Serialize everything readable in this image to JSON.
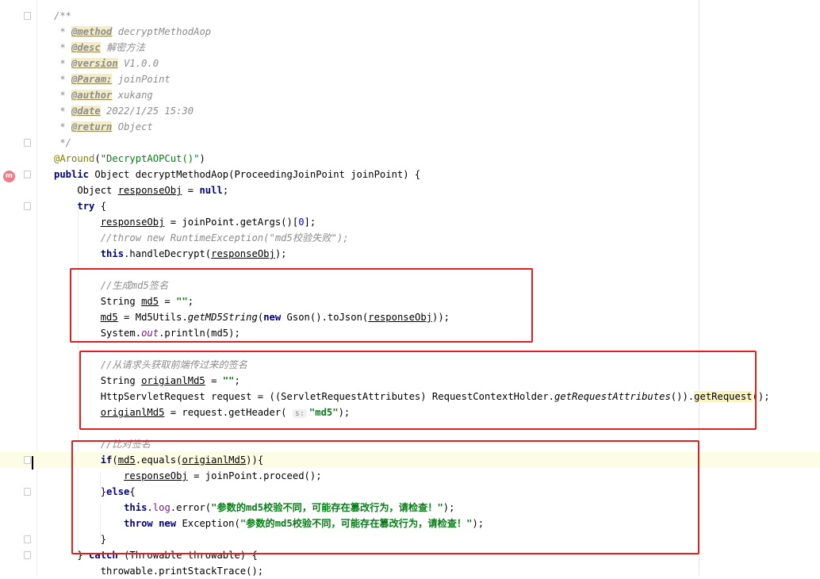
{
  "editor": {
    "accent_color": "#e02020",
    "gutter_icon": "override-method-icon",
    "gutter_icon_text": "m",
    "inlay_hint": "s:",
    "lines": [
      {
        "segments": [
          {
            "t": "/**",
            "c": "cm"
          }
        ]
      },
      {
        "segments": [
          {
            "t": " * ",
            "c": "cm"
          },
          {
            "t": "@method",
            "c": "tag"
          },
          {
            "t": " decryptMethodAop",
            "c": "cm"
          }
        ]
      },
      {
        "segments": [
          {
            "t": " * ",
            "c": "cm"
          },
          {
            "t": "@desc",
            "c": "tag"
          },
          {
            "t": " 解密方法",
            "c": "cm"
          }
        ]
      },
      {
        "segments": [
          {
            "t": " * ",
            "c": "cm"
          },
          {
            "t": "@version",
            "c": "tag"
          },
          {
            "t": " V1.0.0",
            "c": "cm"
          }
        ]
      },
      {
        "segments": [
          {
            "t": " * ",
            "c": "cm"
          },
          {
            "t": "@Param:",
            "c": "tag"
          },
          {
            "t": " joinPoint",
            "c": "cm"
          }
        ]
      },
      {
        "segments": [
          {
            "t": " * ",
            "c": "cm"
          },
          {
            "t": "@author",
            "c": "tag"
          },
          {
            "t": " xukang",
            "c": "cm"
          }
        ]
      },
      {
        "segments": [
          {
            "t": " * ",
            "c": "cm"
          },
          {
            "t": "@date",
            "c": "tag"
          },
          {
            "t": " 2022/1/25 15:30",
            "c": "cm"
          }
        ]
      },
      {
        "segments": [
          {
            "t": " * ",
            "c": "cm"
          },
          {
            "t": "@return",
            "c": "tag"
          },
          {
            "t": " Object",
            "c": "cm"
          }
        ]
      },
      {
        "segments": [
          {
            "t": " */",
            "c": "cm"
          }
        ]
      },
      {
        "segments": [
          {
            "t": "@Around",
            "c": "ann"
          },
          {
            "t": "(",
            "c": ""
          },
          {
            "t": "\"DecryptAOPCut()\"",
            "c": "str2"
          },
          {
            "t": ")",
            "c": ""
          }
        ]
      },
      {
        "segments": [
          {
            "t": "public ",
            "c": "kw"
          },
          {
            "t": "Object decryptMethodAop(ProceedingJoinPoint joinPoint) {",
            "c": ""
          }
        ]
      },
      {
        "segments": [
          {
            "t": "    Object ",
            "c": ""
          },
          {
            "t": "responseObj",
            "c": "ul"
          },
          {
            "t": " = ",
            "c": ""
          },
          {
            "t": "null",
            "c": "kw"
          },
          {
            "t": ";",
            "c": ""
          }
        ]
      },
      {
        "segments": [
          {
            "t": "    ",
            "c": ""
          },
          {
            "t": "try ",
            "c": "kw"
          },
          {
            "t": "{",
            "c": ""
          }
        ]
      },
      {
        "segments": [
          {
            "t": "        ",
            "c": ""
          },
          {
            "t": "responseObj",
            "c": "ul"
          },
          {
            "t": " = joinPoint.getArgs()[",
            "c": ""
          },
          {
            "t": "0",
            "c": "num"
          },
          {
            "t": "];",
            "c": ""
          }
        ]
      },
      {
        "segments": [
          {
            "t": "        //throw new RuntimeException(\"md5校验失败\");",
            "c": "cm"
          }
        ]
      },
      {
        "segments": [
          {
            "t": "        ",
            "c": ""
          },
          {
            "t": "this",
            "c": "kw"
          },
          {
            "t": ".handleDecrypt(",
            "c": ""
          },
          {
            "t": "responseObj",
            "c": "ul"
          },
          {
            "t": ");",
            "c": ""
          }
        ]
      },
      {
        "segments": [
          {
            "t": "",
            "c": ""
          }
        ]
      },
      {
        "segments": [
          {
            "t": "        //生成md5签名",
            "c": "cm"
          }
        ]
      },
      {
        "segments": [
          {
            "t": "        String ",
            "c": ""
          },
          {
            "t": "md5",
            "c": "ul"
          },
          {
            "t": " = ",
            "c": ""
          },
          {
            "t": "\"\"",
            "c": "str"
          },
          {
            "t": ";",
            "c": ""
          }
        ]
      },
      {
        "segments": [
          {
            "t": "        ",
            "c": ""
          },
          {
            "t": "md5",
            "c": "ul"
          },
          {
            "t": " = Md5Utils.",
            "c": ""
          },
          {
            "t": "getMD5String",
            "c": "stat"
          },
          {
            "t": "(",
            "c": ""
          },
          {
            "t": "new ",
            "c": "kw"
          },
          {
            "t": "Gson().toJson(",
            "c": ""
          },
          {
            "t": "responseObj",
            "c": "ul"
          },
          {
            "t": "));",
            "c": ""
          }
        ]
      },
      {
        "segments": [
          {
            "t": "        System.",
            "c": ""
          },
          {
            "t": "out",
            "c": "fldi"
          },
          {
            "t": ".println(md5);",
            "c": ""
          }
        ]
      },
      {
        "segments": [
          {
            "t": "",
            "c": ""
          }
        ]
      },
      {
        "segments": [
          {
            "t": "        //从请求头获取前端传过来的签名",
            "c": "cm"
          }
        ]
      },
      {
        "segments": [
          {
            "t": "        String ",
            "c": ""
          },
          {
            "t": "origianlMd5",
            "c": "ul"
          },
          {
            "t": " = ",
            "c": ""
          },
          {
            "t": "\"\"",
            "c": "str"
          },
          {
            "t": ";",
            "c": ""
          }
        ]
      },
      {
        "segments": [
          {
            "t": "        HttpServletRequest request = ((ServletRequestAttributes) RequestContextHolder.",
            "c": ""
          },
          {
            "t": "getRequestAttributes",
            "c": "stat"
          },
          {
            "t": "()).",
            "c": ""
          },
          {
            "t": "getRequest",
            "c": "hl"
          },
          {
            "t": "();",
            "c": ""
          }
        ]
      },
      {
        "segments": [
          {
            "t": "        ",
            "c": ""
          },
          {
            "t": "origianlMd5",
            "c": "ul"
          },
          {
            "t": " = request.getHeader( ",
            "c": ""
          },
          {
            "t": "HINT",
            "c": "hint"
          },
          {
            "t": "\"md5\"",
            "c": "str"
          },
          {
            "t": ");",
            "c": ""
          }
        ]
      },
      {
        "segments": [
          {
            "t": "",
            "c": ""
          }
        ]
      },
      {
        "segments": [
          {
            "t": "        //比对签名",
            "c": "cm"
          }
        ]
      },
      {
        "segments": [
          {
            "t": "        ",
            "c": ""
          },
          {
            "t": "if",
            "c": "kw"
          },
          {
            "t": "(",
            "c": ""
          },
          {
            "t": "md5",
            "c": "ul"
          },
          {
            "t": ".equals(",
            "c": ""
          },
          {
            "t": "origianlMd5",
            "c": "ul"
          },
          {
            "t": ")){",
            "c": ""
          }
        ]
      },
      {
        "segments": [
          {
            "t": "            ",
            "c": ""
          },
          {
            "t": "responseObj",
            "c": "ul"
          },
          {
            "t": " = joinPoint.proceed();",
            "c": ""
          }
        ]
      },
      {
        "segments": [
          {
            "t": "        }",
            "c": ""
          },
          {
            "t": "else",
            "c": "kw"
          },
          {
            "t": "{",
            "c": ""
          }
        ]
      },
      {
        "segments": [
          {
            "t": "            ",
            "c": ""
          },
          {
            "t": "this",
            "c": "kw"
          },
          {
            "t": ".",
            "c": ""
          },
          {
            "t": "log",
            "c": "fld"
          },
          {
            "t": ".error(",
            "c": ""
          },
          {
            "t": "\"参数的md5校验不同，可能存在篡改行为，请检查！\"",
            "c": "str"
          },
          {
            "t": ");",
            "c": ""
          }
        ]
      },
      {
        "segments": [
          {
            "t": "            ",
            "c": ""
          },
          {
            "t": "throw new ",
            "c": "kw"
          },
          {
            "t": "Exception(",
            "c": ""
          },
          {
            "t": "\"参数的md5校验不同，可能存在篡改行为，请检查！\"",
            "c": "str"
          },
          {
            "t": ");",
            "c": ""
          }
        ]
      },
      {
        "segments": [
          {
            "t": "        }",
            "c": ""
          }
        ]
      },
      {
        "segments": [
          {
            "t": "    } ",
            "c": ""
          },
          {
            "t": "catch ",
            "c": "kw"
          },
          {
            "t": "(Throwable throwable) {",
            "c": ""
          }
        ]
      },
      {
        "segments": [
          {
            "t": "        throwable.printStackTrace();",
            "c": ""
          }
        ]
      }
    ]
  }
}
